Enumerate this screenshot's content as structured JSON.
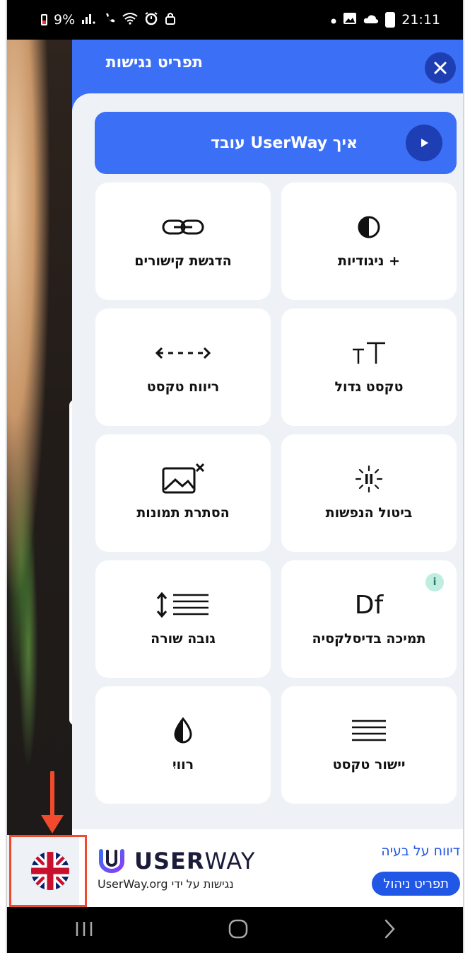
{
  "status_bar": {
    "battery": "9%",
    "time": "21:11"
  },
  "panel": {
    "title": "תפריט נגישות",
    "how_button_label": "איך UserWay עובד",
    "cards": [
      {
        "label": "+ ניגודיות",
        "icon": "contrast-icon"
      },
      {
        "label": "הדגשת קישורים",
        "icon": "link-icon"
      },
      {
        "label": "טקסט גדול",
        "icon": "text-size-icon"
      },
      {
        "label": "ריווח טקסט",
        "icon": "text-spacing-icon"
      },
      {
        "label": "ביטול הנפשות",
        "icon": "pause-animation-icon"
      },
      {
        "label": "הסתרת תמונות",
        "icon": "hide-images-icon"
      },
      {
        "label": "תמיכה בדיסלקסיה",
        "icon": "dyslexia-icon",
        "badge": "i",
        "icon_text": "Df"
      },
      {
        "label": "גובה שורה",
        "icon": "line-height-icon"
      },
      {
        "label": "יישור טקסט",
        "icon": "text-align-icon"
      },
      {
        "label": "רוויִ",
        "icon": "saturation-icon"
      }
    ]
  },
  "footer": {
    "logo_bold": "USER",
    "logo_light": "WAY",
    "credit": "UserWay.org נגישות על ידי",
    "report_link": "דיווח על בעיה",
    "manage_button": "תפריט ניהול"
  },
  "colors": {
    "accent": "#3b6ff6",
    "dark_accent": "#1e3fb3",
    "highlight": "#f24a2c"
  }
}
